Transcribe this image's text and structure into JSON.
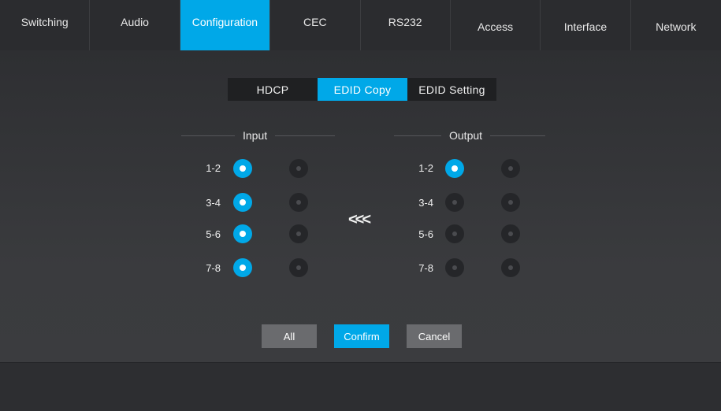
{
  "nav": {
    "items": [
      {
        "label": "Switching"
      },
      {
        "label": "Audio"
      },
      {
        "label": "Configuration"
      },
      {
        "label": "CEC"
      },
      {
        "label": "RS232"
      },
      {
        "label": "Access"
      },
      {
        "label": "Interface"
      },
      {
        "label": "Network"
      }
    ],
    "active_index": 2
  },
  "subtabs": {
    "items": [
      {
        "label": "HDCP"
      },
      {
        "label": "EDID Copy"
      },
      {
        "label": "EDID Setting"
      }
    ],
    "active_index": 1
  },
  "input": {
    "title": "Input",
    "rows": [
      {
        "label": "1-2",
        "selected": 0
      },
      {
        "label": "3-4",
        "selected": 0
      },
      {
        "label": "5-6",
        "selected": 0
      },
      {
        "label": "7-8",
        "selected": 0
      }
    ]
  },
  "output": {
    "title": "Output",
    "rows": [
      {
        "label": "1-2",
        "selected": 0
      },
      {
        "label": "3-4",
        "selected": -1
      },
      {
        "label": "5-6",
        "selected": -1
      },
      {
        "label": "7-8",
        "selected": -1
      }
    ]
  },
  "copy_arrow": "<<<",
  "buttons": {
    "all": "All",
    "confirm": "Confirm",
    "cancel": "Cancel"
  },
  "colors": {
    "accent": "#00a8e8"
  }
}
